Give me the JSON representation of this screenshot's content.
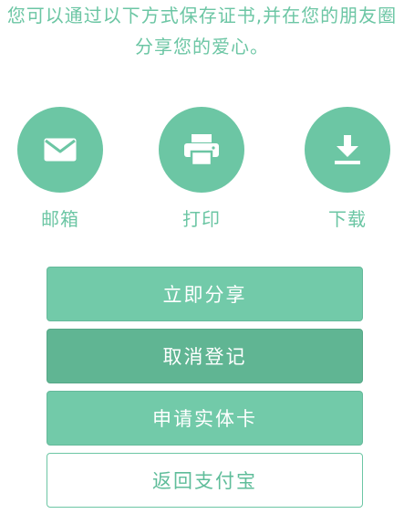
{
  "intro": {
    "line1": "您可以通过以下方式保存证书,并在您的朋友圈",
    "line2": "分享您的爱心。"
  },
  "save_options": [
    {
      "label": "邮箱",
      "icon": "mail-icon"
    },
    {
      "label": "打印",
      "icon": "printer-icon"
    },
    {
      "label": "下载",
      "icon": "download-icon"
    }
  ],
  "actions": {
    "share_now": "立即分享",
    "cancel_registration": "取消登记",
    "apply_physical_card": "申请实体卡",
    "return_alipay": "返回支付宝"
  },
  "colors": {
    "accent": "#6cc6a4",
    "button": "#72caa9",
    "button_dark": "#60b593",
    "background": "#ffffff"
  }
}
